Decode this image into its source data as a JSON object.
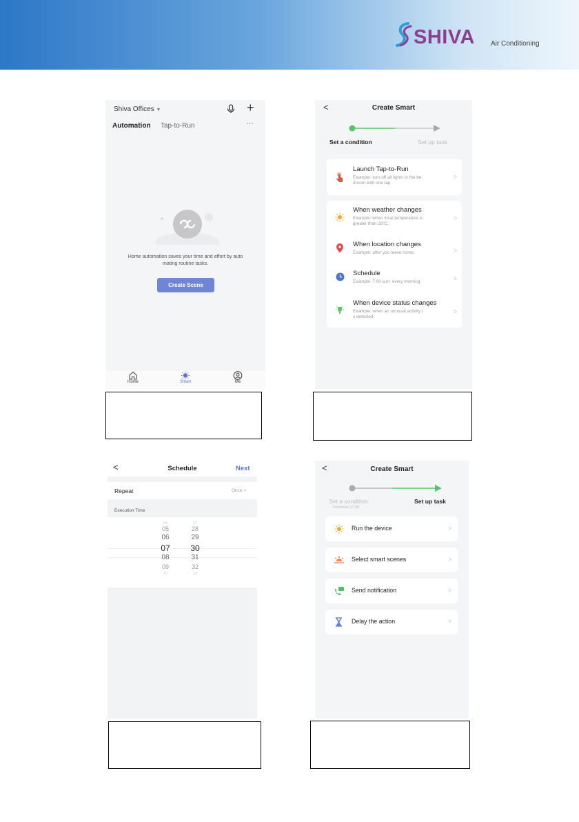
{
  "brand": {
    "name": "SHIVA",
    "tagline": "Air Conditioning",
    "colors": {
      "banner_start": "#2d77c7",
      "word": "#8b3f8f"
    }
  },
  "screen1": {
    "home_name": "Shiva Offices",
    "tabs": [
      "Automation",
      "Tap-to-Run"
    ],
    "more": "···",
    "empty_text_line1": "Home automation saves your time and effort by auto",
    "empty_text_line2": "mating routine tasks.",
    "create_button": "Create Scene",
    "nav": [
      {
        "label": "Home",
        "icon": "home-icon"
      },
      {
        "label": "Smart",
        "icon": "sun-icon"
      },
      {
        "label": "Me",
        "icon": "person-icon"
      }
    ],
    "accent": "#6f86d6"
  },
  "screen2": {
    "back": "<",
    "title": "Create Smart",
    "steps": [
      "Set a condition",
      "Set up task"
    ],
    "launch": {
      "title": "Launch Tap-to-Run",
      "example1": "Example: turn off all lights in the be",
      "example2": "droom with one tap."
    },
    "conditions": [
      {
        "title": "When weather changes",
        "example1": "Example: when local temperature is",
        "example2": "greater than 28°C.",
        "icon": "sun-icon"
      },
      {
        "title": "When location changes",
        "example1": "Example: after you leave home.",
        "example2": "",
        "icon": "location-pin-icon"
      },
      {
        "title": "Schedule",
        "example1": "Example: 7:00 a.m. every morning.",
        "example2": "",
        "icon": "clock-icon"
      },
      {
        "title": "When device status changes",
        "example1": "Example: when an unusual activity i",
        "example2": "s detected.",
        "icon": "device-icon"
      }
    ],
    "chevron": ">"
  },
  "screen3": {
    "back": "<",
    "title": "Schedule",
    "next": "Next",
    "repeat_label": "Repeat",
    "repeat_value": "Once >",
    "section": "Execution Time",
    "hours": [
      "04",
      "05",
      "06",
      "07",
      "08",
      "09",
      "10"
    ],
    "minutes": [
      "27",
      "28",
      "29",
      "30",
      "31",
      "32",
      "33"
    ],
    "selected_hour": "07",
    "selected_minute": "30"
  },
  "screen4": {
    "back": "<",
    "title": "Create Smart",
    "steps": [
      "Set a condition",
      "Set up task"
    ],
    "step_sub": "Schedule 07:30",
    "tasks": [
      {
        "label": "Run the device",
        "icon": "sun-icon"
      },
      {
        "label": "Select smart scenes",
        "icon": "sunrise-icon"
      },
      {
        "label": "Send notification",
        "icon": "message-icon"
      },
      {
        "label": "Delay the action",
        "icon": "hourglass-icon"
      }
    ],
    "chevron": ">"
  }
}
